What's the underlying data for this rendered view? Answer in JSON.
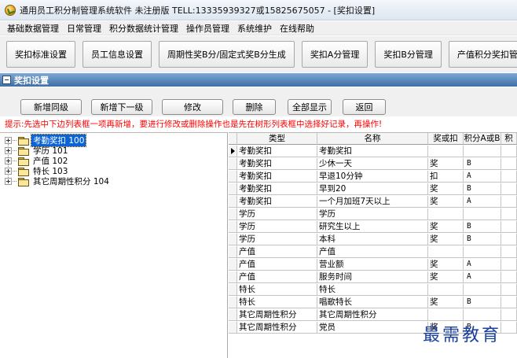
{
  "window": {
    "title": "通用员工积分制管理系统软件 未注册版 TELL:13335939327或15825675057 - [奖扣设置]"
  },
  "menu": [
    "基础数据管理",
    "日常管理",
    "积分数据统计管理",
    "操作员管理",
    "系统维护",
    "在线帮助"
  ],
  "toolbar": [
    "奖扣标准设置",
    "员工信息设置",
    "周期性奖B分/固定式奖B分生成",
    "奖扣A分管理",
    "奖扣B分管理",
    "产值积分奖扣管理"
  ],
  "section": {
    "title": "奖扣设置"
  },
  "actions": {
    "add_same_level": "新增同级",
    "add_next_level": "新增下一级",
    "edit": "修改",
    "delete": "删除",
    "show_all": "全部显示",
    "back": "返回"
  },
  "hint": "提示:先选中下边列表框一项再新增，要进行修改或删除操作也是先在树形列表框中选择好记录，再操作!",
  "tree": [
    {
      "label": "考勤奖扣 100",
      "selected": true
    },
    {
      "label": "学历 101",
      "selected": false
    },
    {
      "label": "产值 102",
      "selected": false
    },
    {
      "label": "特长 103",
      "selected": false
    },
    {
      "label": "其它周期性积分 104",
      "selected": false
    }
  ],
  "grid": {
    "columns": [
      "类型",
      "名称",
      "奖或扣",
      "积分A或B",
      "积"
    ],
    "rows": [
      {
        "type": "考勤奖扣",
        "name": "考勤奖扣",
        "jk": "",
        "ab": ""
      },
      {
        "type": "考勤奖扣",
        "name": "少休一天",
        "jk": "奖",
        "ab": "B"
      },
      {
        "type": "考勤奖扣",
        "name": "早退10分钟",
        "jk": "扣",
        "ab": "A"
      },
      {
        "type": "考勤奖扣",
        "name": "早到20",
        "jk": "奖",
        "ab": "B"
      },
      {
        "type": "考勤奖扣",
        "name": "一个月加班7天以上",
        "jk": "奖",
        "ab": "A"
      },
      {
        "type": "学历",
        "name": "学历",
        "jk": "",
        "ab": ""
      },
      {
        "type": "学历",
        "name": "研究生以上",
        "jk": "奖",
        "ab": "B"
      },
      {
        "type": "学历",
        "name": "本科",
        "jk": "奖",
        "ab": "B"
      },
      {
        "type": "产值",
        "name": "产值",
        "jk": "",
        "ab": ""
      },
      {
        "type": "产值",
        "name": "营业额",
        "jk": "奖",
        "ab": "A"
      },
      {
        "type": "产值",
        "name": "服务时间",
        "jk": "奖",
        "ab": "A"
      },
      {
        "type": "特长",
        "name": "特长",
        "jk": "",
        "ab": ""
      },
      {
        "type": "特长",
        "name": "唱歌特长",
        "jk": "奖",
        "ab": "B"
      },
      {
        "type": "其它周期性积分",
        "name": "其它周期性积分",
        "jk": "",
        "ab": ""
      },
      {
        "type": "其它周期性积分",
        "name": "党员",
        "jk": "奖",
        "ab": "B"
      }
    ]
  },
  "watermark": "最需教育"
}
